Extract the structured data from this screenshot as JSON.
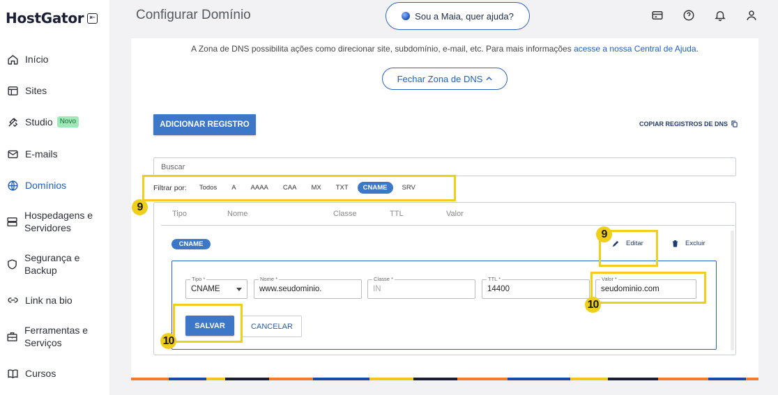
{
  "sidebar": {
    "logo": "HostGator",
    "collapse_glyph": "⇤",
    "items": [
      {
        "label": "Início",
        "icon": "home-icon"
      },
      {
        "label": "Sites",
        "icon": "sites-icon"
      },
      {
        "label": "Studio",
        "icon": "studio-icon",
        "badge": "Novo"
      },
      {
        "label": "E-mails",
        "icon": "mail-icon"
      },
      {
        "label": "Domínios",
        "icon": "globe-icon",
        "active": true
      },
      {
        "label": "Hospedagens e Servidores",
        "icon": "server-icon"
      },
      {
        "label": "Segurança e Backup",
        "icon": "shield-icon"
      },
      {
        "label": "Link na bio",
        "icon": "link-icon"
      },
      {
        "label": "Ferramentas e Serviços",
        "icon": "tools-icon"
      },
      {
        "label": "Cursos",
        "icon": "book-icon"
      }
    ]
  },
  "header": {
    "title": "Configurar Domínio",
    "maia_button": "Sou a Maia, quer ajuda?",
    "icons": [
      "card-icon",
      "help-icon",
      "bell-icon",
      "user-icon"
    ]
  },
  "dns": {
    "info_text": "A Zona de DNS possibilita ações como direcionar site, subdomínio, e-mail, etc. Para mais informações ",
    "info_link": "acesse a nossa Central de Ajuda",
    "info_end": ".",
    "close_button": "Fechar Zona de DNS",
    "add_button": "ADICIONAR REGISTRO",
    "copy_link": "COPIAR REGISTROS DE DNS",
    "search_placeholder": "Buscar",
    "filter_label": "Filtrar por:",
    "filters": [
      "Todos",
      "A",
      "AAAA",
      "CAA",
      "MX",
      "TXT",
      "CNAME",
      "SRV"
    ],
    "selected_filter": "CNAME",
    "columns": [
      "Tipo",
      "Nome",
      "Classe",
      "TTL",
      "Valor"
    ],
    "record_type": "CNAME",
    "edit_label": "Editar",
    "delete_label": "Excluir",
    "form": {
      "tipo_label": "Tipo *",
      "tipo_value": "CNAME",
      "nome_label": "Nome *",
      "nome_value": "www.seudominio.",
      "classe_label": "Classe *",
      "classe_value": "IN",
      "ttl_label": "TTL *",
      "ttl_value": "14400",
      "valor_label": "Valor *",
      "valor_value": "seudominio.com",
      "save": "SALVAR",
      "cancel": "CANCELAR"
    }
  },
  "annotations": {
    "step_filter": "9",
    "step_edit": "9",
    "step_valor": "10",
    "step_save": "10",
    "color": "#f0cf1b"
  }
}
